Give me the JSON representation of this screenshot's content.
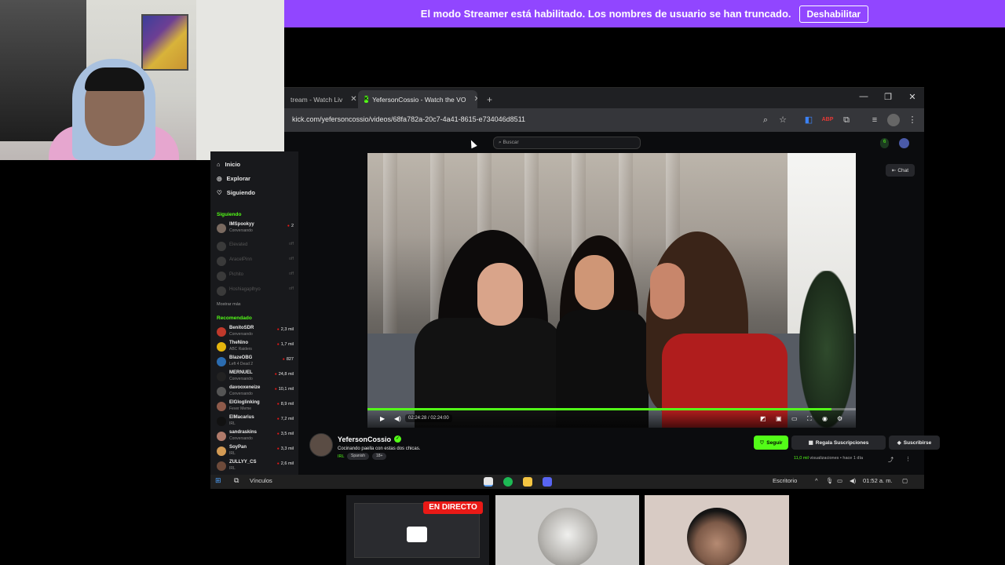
{
  "banner": {
    "message": "El modo Streamer está habilitado. Los nombres de usuario se han truncado.",
    "button": "Deshabilitar"
  },
  "browser": {
    "tabs": [
      {
        "label": "tream - Watch Liv"
      },
      {
        "label": "YefersonCossio - Watch the VO"
      }
    ],
    "new_tab": "+",
    "url": "kick.com/yefersoncossio/videos/68fa782a-20c7-4a41-8615-e734046d8511",
    "window_controls": {
      "minimize": "—",
      "restore": "❐",
      "close": "✕"
    }
  },
  "kick_header": {
    "search_placeholder": "Buscar",
    "pill": "6"
  },
  "sidebar": {
    "nav": [
      {
        "label": "Inicio",
        "icon": "home-icon"
      },
      {
        "label": "Explorar",
        "icon": "compass-icon"
      },
      {
        "label": "Siguiendo",
        "icon": "heart-icon"
      }
    ],
    "following_title": "Siguiendo",
    "following": [
      {
        "name": "IMSpookyy",
        "category": "Conversando",
        "viewers": "2",
        "online": true
      },
      {
        "name": "Elevated",
        "category": "",
        "viewers": "off",
        "online": false
      },
      {
        "name": "AracelPinn",
        "category": "",
        "viewers": "off",
        "online": false
      },
      {
        "name": "Pichito",
        "category": "",
        "viewers": "off",
        "online": false
      },
      {
        "name": "Hoshiagaplhyo",
        "category": "",
        "viewers": "off",
        "online": false
      }
    ],
    "show_more": "Mostrar más",
    "recommended_title": "Recomendado",
    "recommended": [
      {
        "name": "BenitoSDR",
        "category": "Conversando",
        "viewers": "2,3 mil"
      },
      {
        "name": "TheNino",
        "category": "ABC Raiders",
        "viewers": "1,7 mil"
      },
      {
        "name": "BlazeOBG",
        "category": "Left 4 Dead 2",
        "viewers": "827"
      },
      {
        "name": "MERNUEL",
        "category": "Conversando",
        "viewers": "24,8 mil"
      },
      {
        "name": "davooxeneize",
        "category": "Conversando",
        "viewers": "10,1 mil"
      },
      {
        "name": "ElGloglinking",
        "category": "Fever Meme",
        "viewers": "8,9 mil"
      },
      {
        "name": "ElMacarius",
        "category": "IRL",
        "viewers": "7,2 mil"
      },
      {
        "name": "sandraskins",
        "category": "Conversando",
        "viewers": "3,5 mil"
      },
      {
        "name": "SoyPan",
        "category": "IRL",
        "viewers": "3,3 mil"
      },
      {
        "name": "ZULLYY_CS",
        "category": "IRL",
        "viewers": "2,6 mil"
      }
    ]
  },
  "video": {
    "time": "02:24:28 / 02:24:00",
    "progress": 0.95
  },
  "chat_button": "Chat",
  "channel": {
    "name": "YefersonCossio",
    "title": "Cocinando paella con estas dos chicas.",
    "category": "IRL",
    "tags": [
      "Spanish",
      "18+"
    ],
    "follow": "Seguir",
    "gift": "Regala Suscripciones",
    "subscribe": "Suscribirse",
    "views": "11,0 mil",
    "views_label": "visualizaciones",
    "age": "hace 1 día"
  },
  "taskbar": {
    "links_label": "Vínculos",
    "desktop_label": "Escritorio",
    "clock": "01:52 a. m."
  },
  "thumbnails": {
    "live_badge": "EN DIRECTO"
  }
}
